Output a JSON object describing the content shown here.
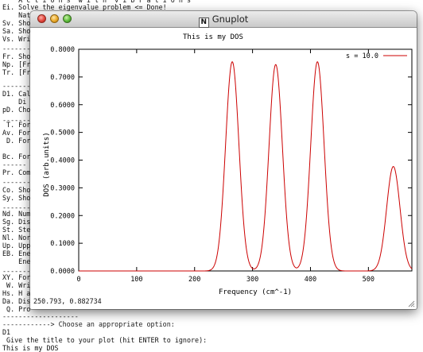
{
  "terminal": {
    "lines": [
      "    A c t i o n s  w i t h  v i b r a t i o n s",
      "Ei. Solve the eigenvalue problem <= Done!",
      "    Nat",
      "Sv. Sho",
      "Sa. Sho",
      "Vs. Wri",
      "--------",
      "Fr. Sho",
      "Np. [Fr",
      "Tr. [Fr",
      "--------",
      "D1. Cal",
      "    Di",
      "pD. Cho",
      "--------",
      " T. For",
      "Av. For",
      " D. For",
      "",
      "Bc. For",
      "------ C",
      "Pr. Com",
      "--------",
      "Co. Sho",
      "Sy. Sho",
      "--------",
      "Nd. Num",
      "Sg. Dis",
      "St. Ste",
      "Nl. Nor",
      "Up. Upp",
      "EB. Ene",
      "    Ene",
      "--------",
      "XY. For",
      " W. Wri",
      "Hs. H a",
      "Da. Dis",
      " Q. Pro",
      "-------------------",
      "------------> Choose an appropriate option:",
      "D1",
      " Give the title to your plot (hit ENTER to ignore):",
      "This is my DOS"
    ]
  },
  "window": {
    "title": "Gnuplot",
    "x_icon": "N"
  },
  "coord_readout": "250.793,  0.882734",
  "icons": [
    "close-button-red",
    "minimize-button-yellow",
    "zoom-button-green",
    "x11-icon",
    "resize-grip-icon"
  ],
  "colors": {
    "curve": "#cc0000",
    "text": "#000000"
  },
  "chart_data": {
    "type": "line",
    "title": "This is my DOS",
    "xlabel": "Frequency (cm^-1)",
    "ylabel": "DOS (arb.units)",
    "xlim": [
      0,
      575
    ],
    "ylim": [
      0,
      0.8
    ],
    "x_ticks": [
      0,
      100,
      200,
      300,
      400,
      500
    ],
    "y_ticks": [
      0,
      0.1,
      0.2,
      0.3,
      0.4,
      0.5,
      0.6,
      0.7,
      0.8
    ],
    "x_tick_labels": [
      "0",
      "100",
      "200",
      "300",
      "400",
      "500"
    ],
    "y_tick_labels": [
      "0.0000",
      "0.1000",
      "0.2000",
      "0.3000",
      "0.4000",
      "0.5000",
      "0.6000",
      "0.7000",
      "0.8000"
    ],
    "legend": "top-right",
    "grid": false,
    "series": [
      {
        "name": "s =  10.0",
        "peaks": [
          {
            "x": 265,
            "y": 0.755
          },
          {
            "x": 340,
            "y": 0.745
          },
          {
            "x": 412,
            "y": 0.755
          },
          {
            "x": 543,
            "y": 0.377
          }
        ],
        "smearing": 10.0
      }
    ]
  }
}
